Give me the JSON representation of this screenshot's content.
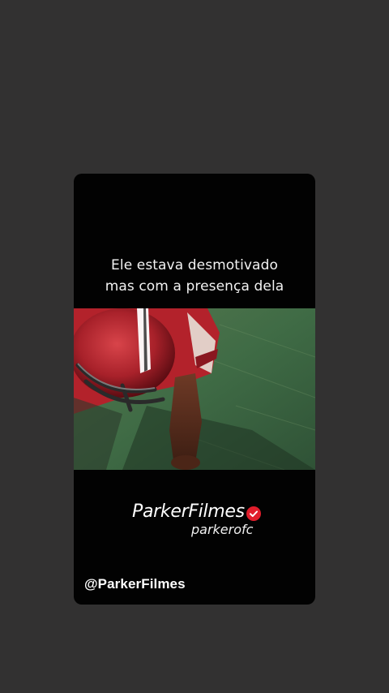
{
  "story": {
    "caption_lines": [
      "Ele estava desmotivado",
      "mas com a presença dela"
    ],
    "brand_name": "ParkerFilmes",
    "brand_subtitle": "parkerofc",
    "handle": "@ParkerFilmes",
    "verified_icon": "verified-badge-icon",
    "colors": {
      "background": "#323131",
      "card": "#020202",
      "badge": "#e11d2b",
      "field": "#3f6b45"
    }
  }
}
